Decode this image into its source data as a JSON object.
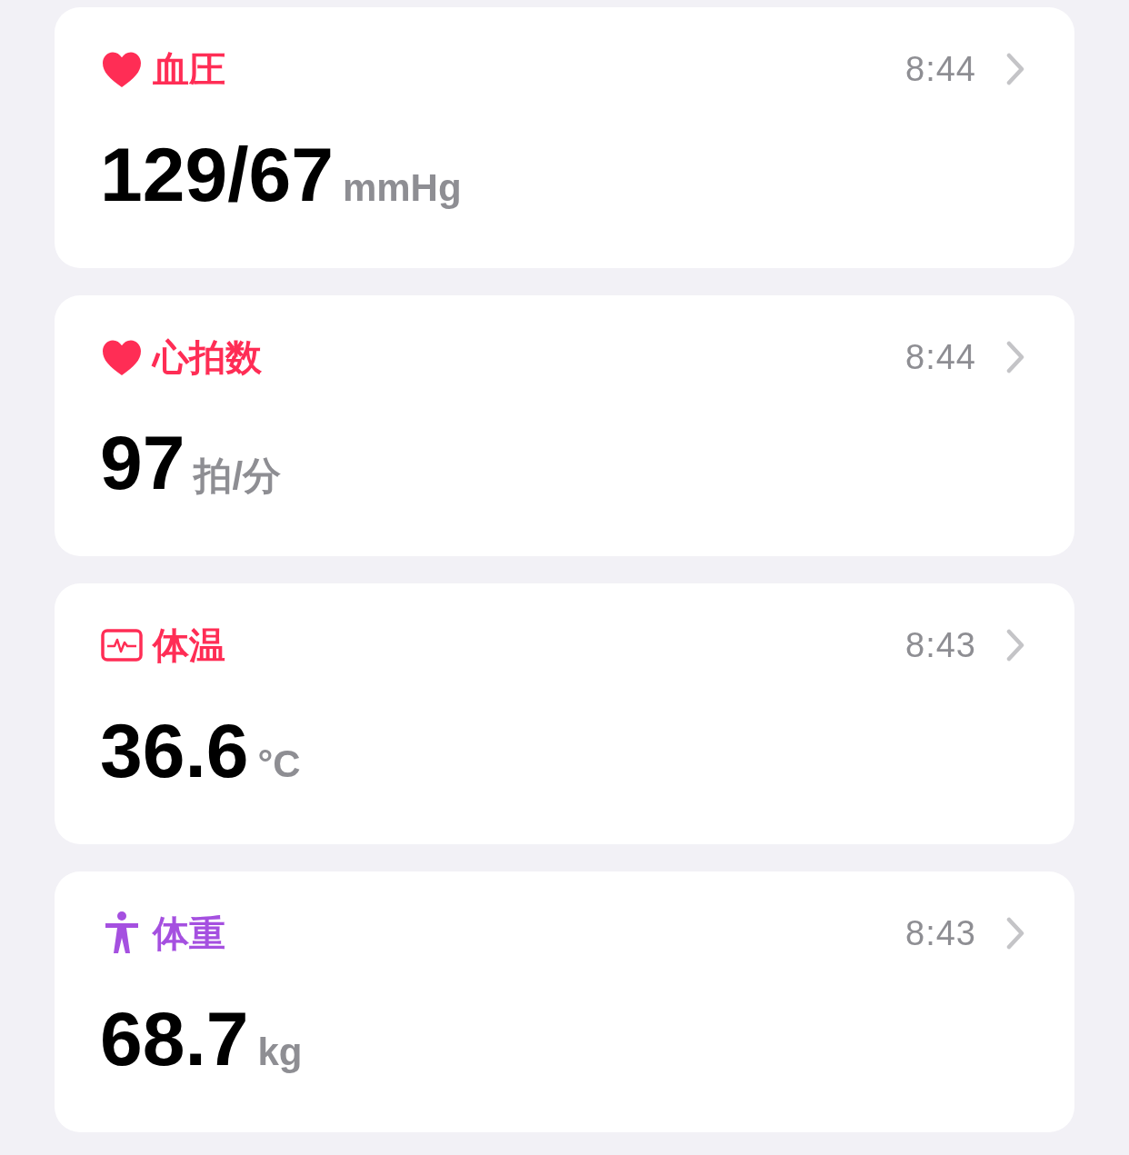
{
  "cards": [
    {
      "kind": "heart",
      "title": "血圧",
      "color": "#ff2d55",
      "time": "8:44",
      "value": "129/67",
      "unit": "mmHg"
    },
    {
      "kind": "heart",
      "title": "心拍数",
      "color": "#ff2d55",
      "time": "8:44",
      "value": "97",
      "unit": "拍/分"
    },
    {
      "kind": "monitor",
      "title": "体温",
      "color": "#ff2d55",
      "time": "8:43",
      "value": "36.6",
      "unit": "°C"
    },
    {
      "kind": "figure",
      "title": "体重",
      "color": "#a550e0",
      "time": "8:43",
      "value": "68.7",
      "unit": "kg"
    }
  ]
}
